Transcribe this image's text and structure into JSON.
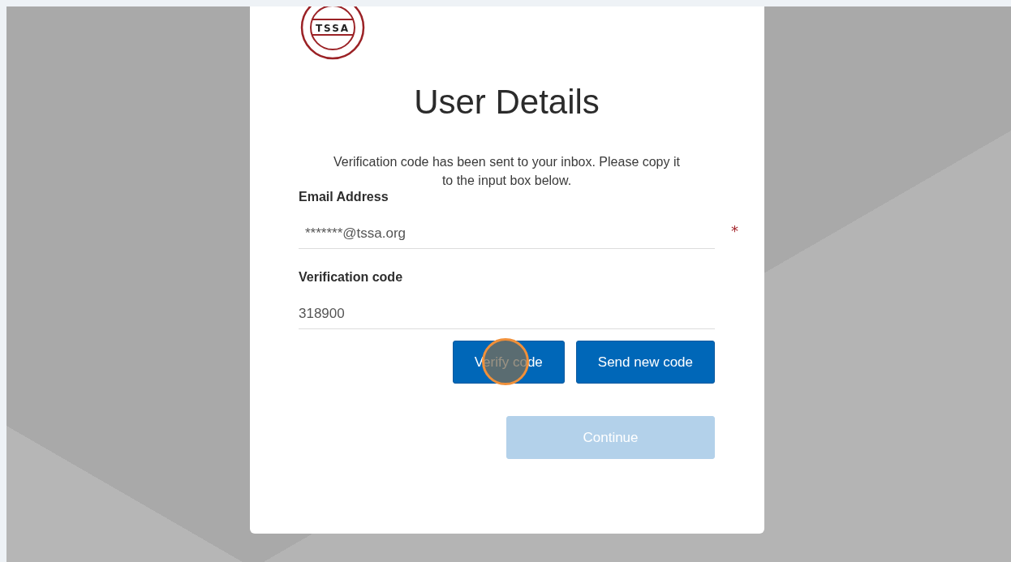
{
  "logo": {
    "text": "TSSA"
  },
  "title": "User Details",
  "message": "Verification code has been sent to your inbox. Please copy it to the input box below.",
  "fields": [
    {
      "label": "Email Address",
      "value": "*******@tssa.org",
      "required_mark": "*"
    },
    {
      "label": "Verification code",
      "value": "318900"
    }
  ],
  "buttons": [
    {
      "label": "Verify code",
      "disabled": false,
      "clicked": true
    },
    {
      "label": "Send new code",
      "disabled": false,
      "clicked": false
    }
  ],
  "continue_button": {
    "label": "Continue",
    "disabled": true
  }
}
